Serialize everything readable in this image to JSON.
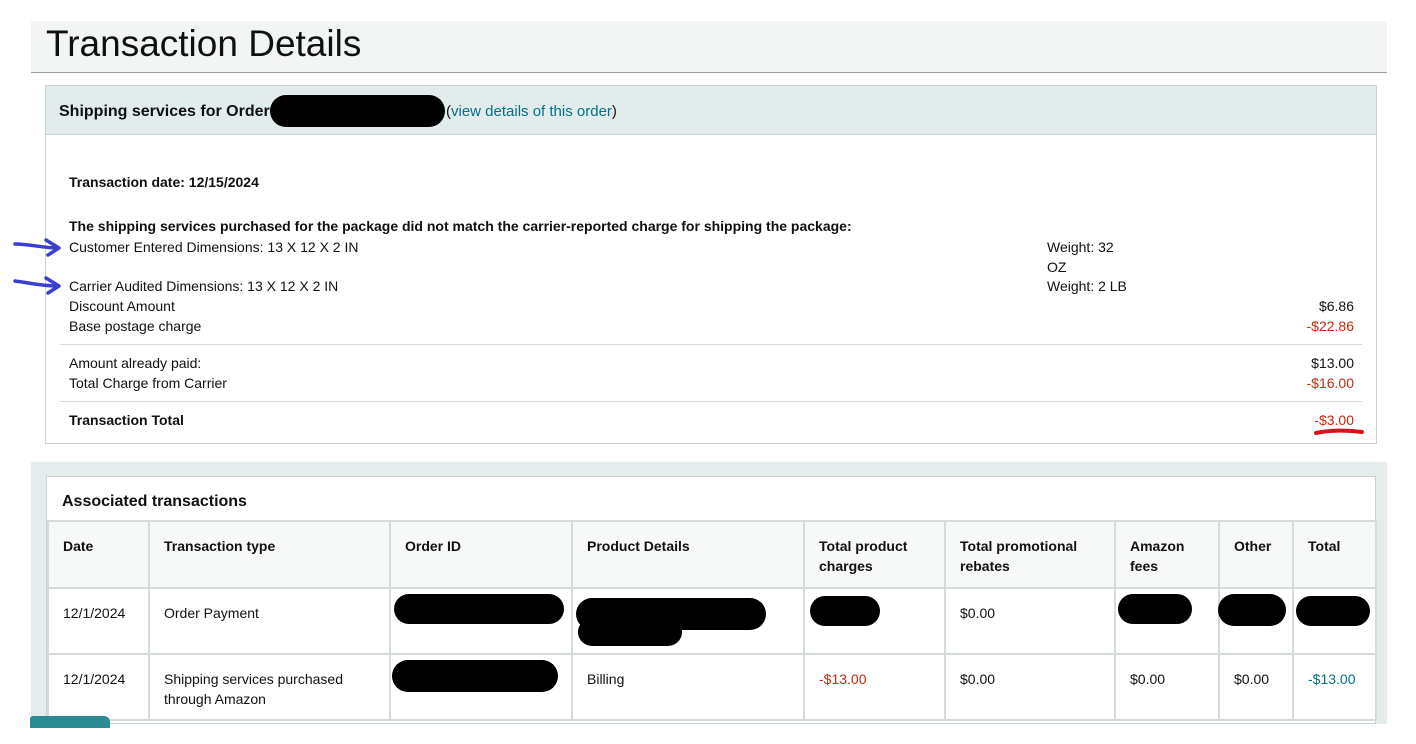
{
  "page": {
    "title": "Transaction Details"
  },
  "panel": {
    "header_prefix": "Shipping services for Order",
    "link_open": "(",
    "link_text": "view details of this order",
    "link_close": ")",
    "transaction_date": "Transaction date: 12/15/2024",
    "mismatch_notice": "The shipping services purchased for the package did not match the carrier-reported charge for shipping the package:",
    "customer_dims": "Customer Entered Dimensions: 13 X 12 X 2 IN",
    "customer_weight_line1": "Weight: 32",
    "customer_weight_line2": "OZ",
    "carrier_dims": "Carrier Audited Dimensions: 13 X 12 X 2 IN",
    "carrier_weight": "Weight: 2 LB",
    "discount_label": "Discount Amount",
    "discount_value": "$6.86",
    "base_postage_label": "Base postage charge",
    "base_postage_value": "-$22.86",
    "already_paid_label": "Amount already paid:",
    "already_paid_value": "$13.00",
    "carrier_charge_label": "Total Charge from Carrier",
    "carrier_charge_value": "-$16.00",
    "total_label": "Transaction Total",
    "total_value": "-$3.00"
  },
  "associated": {
    "title": "Associated transactions",
    "columns": [
      "Date",
      "Transaction type",
      "Order ID",
      "Product Details",
      "Total product charges",
      "Total promotional rebates",
      "Amazon fees",
      "Other",
      "Total"
    ],
    "rows": [
      {
        "date": "12/1/2024",
        "type": "Order Payment",
        "order_id": "",
        "product": "",
        "product_charges": "",
        "rebates": "$0.00",
        "fees": "",
        "other": "",
        "total": ""
      },
      {
        "date": "12/1/2024",
        "type": "Shipping services purchased through Amazon",
        "order_id": "",
        "product": "Billing",
        "product_charges": "-$13.00",
        "rebates": "$0.00",
        "fees": "$0.00",
        "other": "$0.00",
        "total": "-$13.00"
      }
    ]
  },
  "colors": {
    "negative": "#c7290b",
    "link": "#007185",
    "header_bg": "#e3ecec",
    "annotation_blue": "#3a3fd0",
    "annotation_red": "#e0101a"
  },
  "icons": {
    "arrow": "hand-drawn-arrow-icon",
    "underline": "hand-drawn-underline-icon"
  }
}
